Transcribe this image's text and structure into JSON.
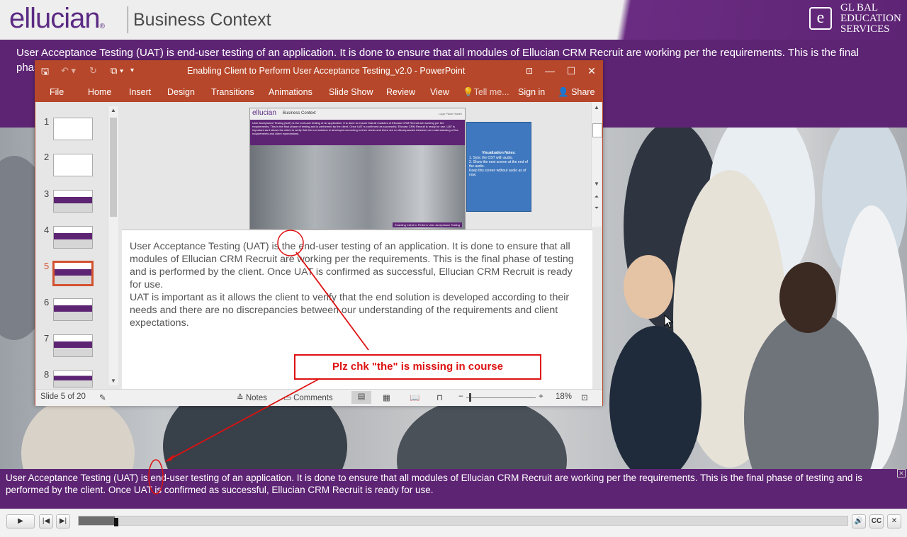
{
  "header": {
    "logo": "ellucian",
    "logo_mark": "®",
    "title": "Business Context",
    "ges_lines": [
      "GL BAL",
      "EDUCATION",
      "SERVICES"
    ],
    "ges_letter": "e"
  },
  "band": {
    "text": "User Acceptance Testing (UAT) is end-user testing of an application. It is done to ensure that all modules of Ellucian CRM Recruit are working per the requirements. This is the final phase of testing and is performed by the client. Once UAT is confirmed as successful, Ellucian CRM Recruit is ready for use."
  },
  "ppt": {
    "title": "Enabling Client to Perform User Acceptance Testing_v2.0 - PowerPoint",
    "tabs": [
      "File",
      "Home",
      "Insert",
      "Design",
      "Transitions",
      "Animations",
      "Slide Show",
      "Review",
      "View",
      "Tell me...",
      "Sign in",
      "Share"
    ],
    "thumb_numbers": [
      "1",
      "2",
      "3",
      "4",
      "5",
      "6",
      "7",
      "8"
    ],
    "selected_slide": "5",
    "slide": {
      "logo": "ellucian",
      "title": "Business Context",
      "band_text": "User Acceptance Testing (UAT) is the end-user testing of an application. It is done to ensure that all modules of Ellucian CRM Recruit are working per the requirements. This is the final phase of testing and is performed by the client. Once UAT is confirmed as successful, Ellucian CRM Recruit is ready for use. UAT is important as it allows the client to verify that the end solution is developed according to their needs and there are no discrepancies between our understanding of the requirements and client expectations.",
      "footer": "Enabling Client to Perform User Acceptance Testing",
      "logo_placeholder": "Logo Place Holder"
    },
    "viz_notes": {
      "title": "Visualization Notes:",
      "items": [
        "1.  Sync the OST with audio.",
        "2.  Show the next screen at the end of the audio.",
        "Keep this screen without audio as of now."
      ]
    },
    "notes": {
      "p1": "User Acceptance Testing (UAT) is the end-user testing of an application. It is done to ensure that all modules of Ellucian CRM Recruit are working per the requirements. This is the final phase of testing and is performed by the client. Once UAT is confirmed as successful, Ellucian CRM Recruit is ready for use.",
      "p2": "UAT is important as it allows the client to verify that the end solution is developed according to their needs and there are no discrepancies between our understanding of the requirements and client expectations."
    },
    "status": {
      "slide_of": "Slide 5 of 20",
      "notes": "Notes",
      "comments": "Comments",
      "zoom": "18%"
    }
  },
  "annotation": {
    "text": "Plz chk \"the\" is missing in course",
    "color": "#dd1111"
  },
  "caption": {
    "text": "User Acceptance Testing (UAT) is end-user testing of an application. It is done to ensure that all modules of Ellucian CRM Recruit are working per the requirements. This is the final phase of testing and is performed by the client. Once UAT is confirmed as successful, Ellucian CRM Recruit is ready for use.",
    "close": "✕"
  },
  "player": {
    "progress": 0.047,
    "play": "▶",
    "prev": "|◀",
    "next": "▶|",
    "cc": "CC",
    "close": "✕",
    "volume": "🔊"
  },
  "colors": {
    "brand_purple": "#5e2474",
    "ppt_red": "#b7472a",
    "annotation_red": "#dd1111"
  }
}
